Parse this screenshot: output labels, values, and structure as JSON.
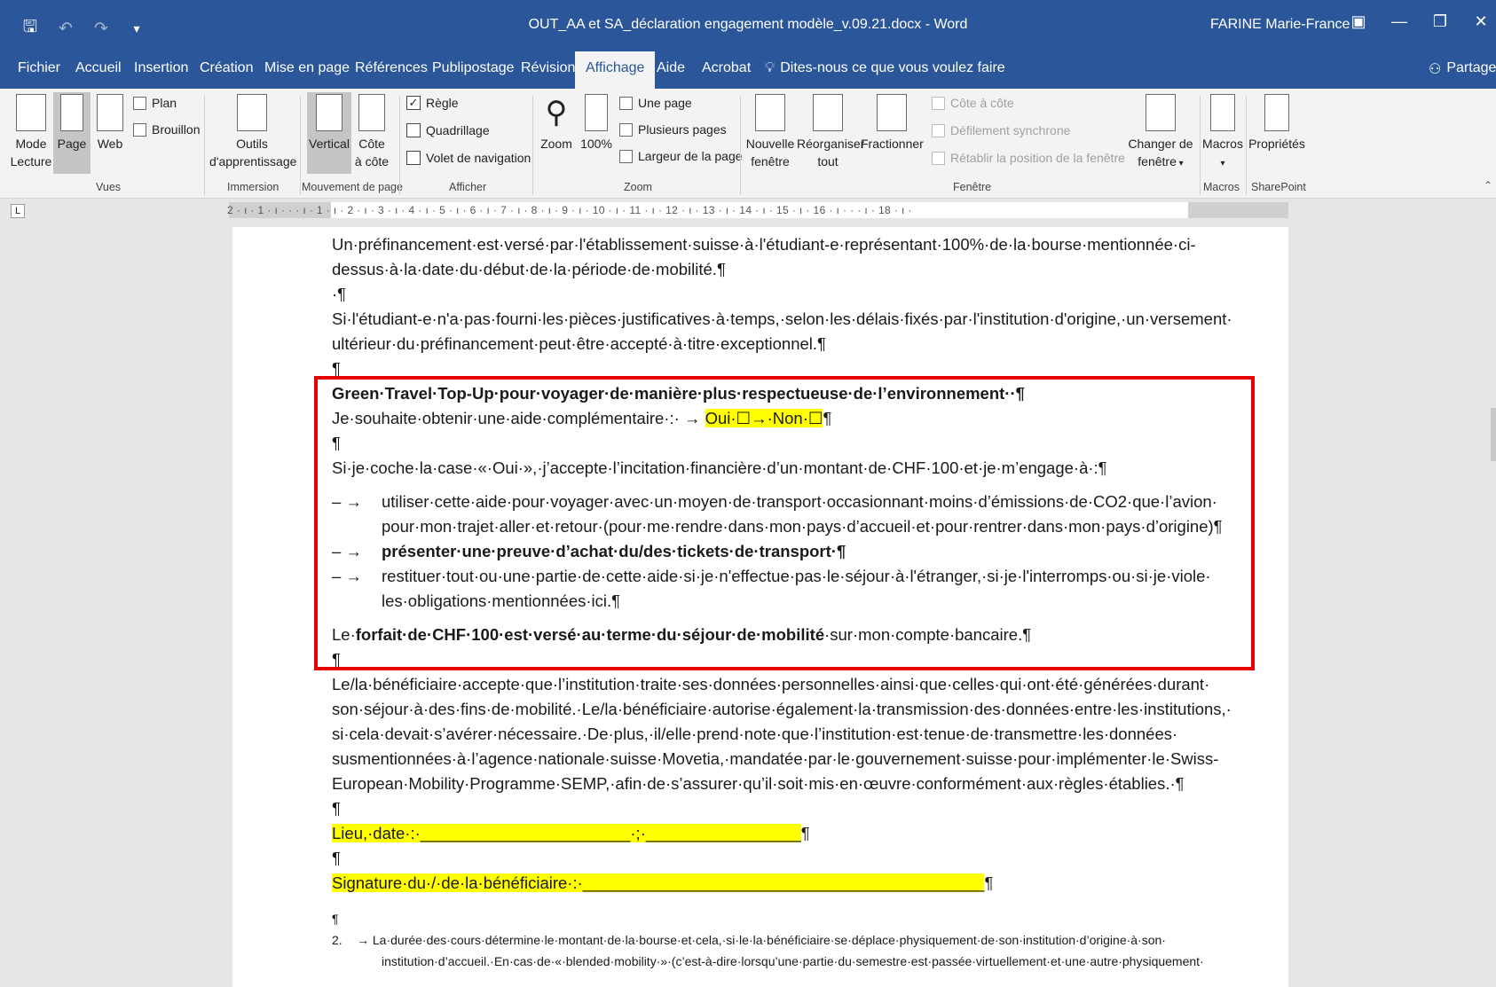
{
  "titlebar": {
    "doc_title": "OUT_AA et SA_déclaration engagement modèle_v.09.21.docx  -  Word",
    "user": "FARINE Marie-France",
    "icons": [
      "save-icon",
      "undo-icon",
      "redo-icon",
      "customize-qat-icon"
    ],
    "window_buttons": [
      "ribbon-display-icon",
      "minimize-icon",
      "restore-icon",
      "close-icon"
    ],
    "glyphs": {
      "save": "🖫",
      "undo": "↶",
      "redo": "↷",
      "customize": "▾",
      "ribbon": "▣",
      "min": "—",
      "restore": "❐",
      "close": "✕"
    }
  },
  "tabs": {
    "fichier": "Fichier",
    "accueil": "Accueil",
    "insertion": "Insertion",
    "creation": "Création",
    "mise_en_page": "Mise en page",
    "references": "Références",
    "publipostage": "Publipostage",
    "revision": "Révision",
    "affichage": "Affichage",
    "aide": "Aide",
    "acrobat": "Acrobat",
    "tell_me": "Dites-nous ce que vous voulez faire",
    "share": "Partager",
    "active": "Affichage"
  },
  "ribbon": {
    "vues": {
      "mode_lecture_1": "Mode",
      "mode_lecture_2": "Lecture",
      "page": "Page",
      "web": "Web",
      "plan": "Plan",
      "brouillon": "Brouillon",
      "label": "Vues"
    },
    "immersion": {
      "outils_1": "Outils",
      "outils_2": "d'apprentissage",
      "label": "Immersion"
    },
    "mouvement": {
      "vertical": "Vertical",
      "cote_1": "Côte",
      "cote_2": "à côte",
      "label": "Mouvement de page"
    },
    "afficher": {
      "regle": "Règle",
      "quadrillage": "Quadrillage",
      "volet": "Volet de navigation",
      "label": "Afficher",
      "regle_checked": true,
      "quadrillage_checked": false,
      "volet_checked": false
    },
    "zoom": {
      "zoom": "Zoom",
      "pct": "100%",
      "une_page": "Une page",
      "plusieurs": "Plusieurs pages",
      "largeur": "Largeur de la page",
      "label": "Zoom"
    },
    "fenetre": {
      "nouvelle_1": "Nouvelle",
      "nouvelle_2": "fenêtre",
      "reorg_1": "Réorganiser",
      "reorg_2": "tout",
      "fractionner": "Fractionner",
      "cote": "Côte à côte",
      "defil": "Défilement synchrone",
      "retablir": "Rétablir la position de la fenêtre",
      "changer_1": "Changer de",
      "changer_2": "fenêtre",
      "label": "Fenêtre"
    },
    "macros": {
      "macros": "Macros",
      "label": "Macros"
    },
    "sharepoint": {
      "proprietes": "Propriétés",
      "label": "SharePoint"
    }
  },
  "ruler": {
    "numbers": "2 · ı · 1 · ı ·  ·  · ı · 1 · ı · 2 · ı · 3 · ı · 4 · ı · 5 · ı · 6 · ı · 7 · ı · 8 · ı · 9 · ı · 10 · ı · 11 · ı · 12 · ı · 13 · ı · 14 · ı · 15 · ı · 16 · ı ·  ·  · ı · 18 · ı ·",
    "tab_selector": "L"
  },
  "document": {
    "p1a": "Un·préfinancement·est·versé·par·l'établissement·suisse·à·l'étudiant-e·représentant·100%·de·la·bourse·mentionnée·ci-",
    "p1b": "dessus·à·la·date·du·début·de·la·période·de·mobilité.¶",
    "p2": "·¶",
    "p3a": "Si·l'étudiant-e·n'a·pas·fourni·les·pièces·justificatives·à·temps,·selon·les·délais·fixés·par·l'institution·d'origine,·un·versement·",
    "p3b": "ultérieur·du·préfinancement·peut·être·accepté·à·titre·exceptionnel.¶",
    "p4": "¶",
    "green_title": "Green·Travel·Top-Up·pour·voyager·de·manière·plus·respectueuse·de·l’environnement··¶",
    "wish_a": "Je·souhaite·obtenir·une·aide·complémentaire·:·    →    ",
    "wish_hl": "Oui·☐→·Non·☐",
    "wish_b": "¶",
    "p5": "¶",
    "coche": "Si·je·coche·la·case·«·Oui·»,·j’accepte·l’incitation·financière·d’un·montant·de·CHF·100·et·je·m’engage·à·:¶",
    "dash": "–   →",
    "li1a": "utiliser·cette·aide·pour·voyager·avec·un·moyen·de·transport·occasionnant·moins·d’émissions·de·CO2·que·l’avion·",
    "li1b": "pour·mon·trajet·aller·et·retour·(pour·me·rendre·dans·mon·pays·d’accueil·et·pour·rentrer·dans·mon·pays·d’origine)¶",
    "li2": "présenter·une·preuve·d’achat·du/des·tickets·de·transport·¶",
    "li3a": "restituer·tout·ou·une·partie·de·cette·aide·si·je·n'effectue·pas·le·séjour·à·l'étranger,·si·je·l'interromps·ou·si·je·viole·",
    "li3b": "les·obligations·mentionnées·ici.¶",
    "forfait_a": "Le·",
    "forfait_b": "forfait·de·CHF·100·est·versé·au·terme·du·séjour·de·mobilité",
    "forfait_c": "·sur·mon·compte·bancaire.¶",
    "p6": "¶",
    "ben1": "Le/la·bénéficiaire·accepte·que·l’institution·traite·ses·données·personnelles·ainsi·que·celles·qui·ont·été·générées·durant·",
    "ben2": "son·séjour·à·des·fins·de·mobilité.·Le/la·bénéficiaire·autorise·également·la·transmission·des·données·entre·les·institutions,·",
    "ben3": "si·cela·devait·s’avérer·nécessaire.·De·plus,·il/elle·prend·note·que·l’institution·est·tenue·de·transmettre·les·données·",
    "ben4": "susmentionnées·à·l’agence·nationale·suisse·Movetia,·mandatée·par·le·gouvernement·suisse·pour·implémenter·le·Swiss-",
    "ben5": "European·Mobility·Programme·SEMP,·afin·de·s’assurer·qu’il·soit·mis·en·œuvre·conformément·aux·règles·établies.·¶",
    "p7": "¶",
    "lieu": "Lieu,·date·:·_______________________·;·_________________",
    "lieu_end": "¶",
    "p8": "¶",
    "signature": "Signature·du·/·de·la·bénéficiaire·:·____________________________________________",
    "sig_end": "¶",
    "p9": "¶",
    "fn_num": "2.",
    "fn1": "→    La·durée·des·cours·détermine·le·montant·de·la·bourse·et·cela,·si·le·la·bénéficiaire·se·déplace·physiquement·de·son·institution·d’origine·à·son·",
    "fn2": "institution·d’accueil.·En·cas·de·«·blended·mobility·»·(c’est-à-dire·lorsqu’une·partie·du·semestre·est·passée·virtuellement·et·une·autre·physiquement·"
  },
  "colors": {
    "word_blue": "#2b579a",
    "highlight": "#ffff00",
    "annotation_red": "#e60000"
  }
}
